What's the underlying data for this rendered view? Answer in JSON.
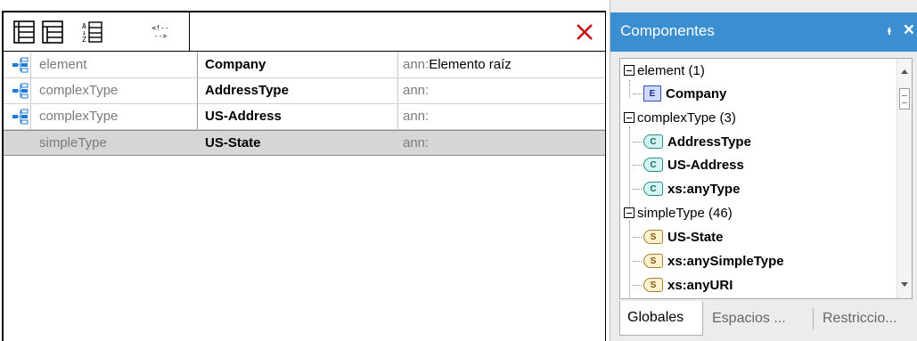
{
  "schema_view": {
    "toolbar": {
      "buttons": [
        {
          "name": "expand-all-icon"
        },
        {
          "name": "collapse-all-icon"
        },
        {
          "name": "sort-az-icon"
        },
        {
          "name": "comment-icon",
          "text": "<!-- -->"
        }
      ],
      "close_icon": "close-x-icon"
    },
    "rows": [
      {
        "kind": "element",
        "name": "Company",
        "ann_prefix": "ann:",
        "ann_value": "Elemento raíz",
        "icon": "global-component-icon",
        "selected": false
      },
      {
        "kind": "complexType",
        "name": "AddressType",
        "ann_prefix": "ann:",
        "ann_value": "",
        "icon": "global-component-icon",
        "selected": false
      },
      {
        "kind": "complexType",
        "name": "US-Address",
        "ann_prefix": "ann:",
        "ann_value": "",
        "icon": "global-component-icon",
        "selected": false
      },
      {
        "kind": "simpleType",
        "name": "US-State",
        "ann_prefix": "ann:",
        "ann_value": "",
        "icon": "",
        "selected": true
      }
    ]
  },
  "components_panel": {
    "title": "Componentes",
    "pin_label": "ᵻ",
    "close_label": "×",
    "header_color": "#3b8fd0",
    "groups": [
      {
        "label": "element (1)",
        "items": [
          {
            "badge": "E",
            "type": "e",
            "label": "Company"
          }
        ]
      },
      {
        "label": "complexType (3)",
        "items": [
          {
            "badge": "C",
            "type": "c",
            "label": "AddressType"
          },
          {
            "badge": "C",
            "type": "c",
            "label": "US-Address"
          },
          {
            "badge": "C",
            "type": "c",
            "label": "xs:anyType"
          }
        ]
      },
      {
        "label": "simpleType (46)",
        "items": [
          {
            "badge": "S",
            "type": "s",
            "label": "US-State"
          },
          {
            "badge": "S",
            "type": "s",
            "label": "xs:anySimpleType"
          },
          {
            "badge": "S",
            "type": "s",
            "label": "xs:anyURI"
          }
        ]
      }
    ],
    "tabs": [
      "Globales",
      "Espacios ...",
      "Restriccio..."
    ],
    "active_tab": 0
  }
}
